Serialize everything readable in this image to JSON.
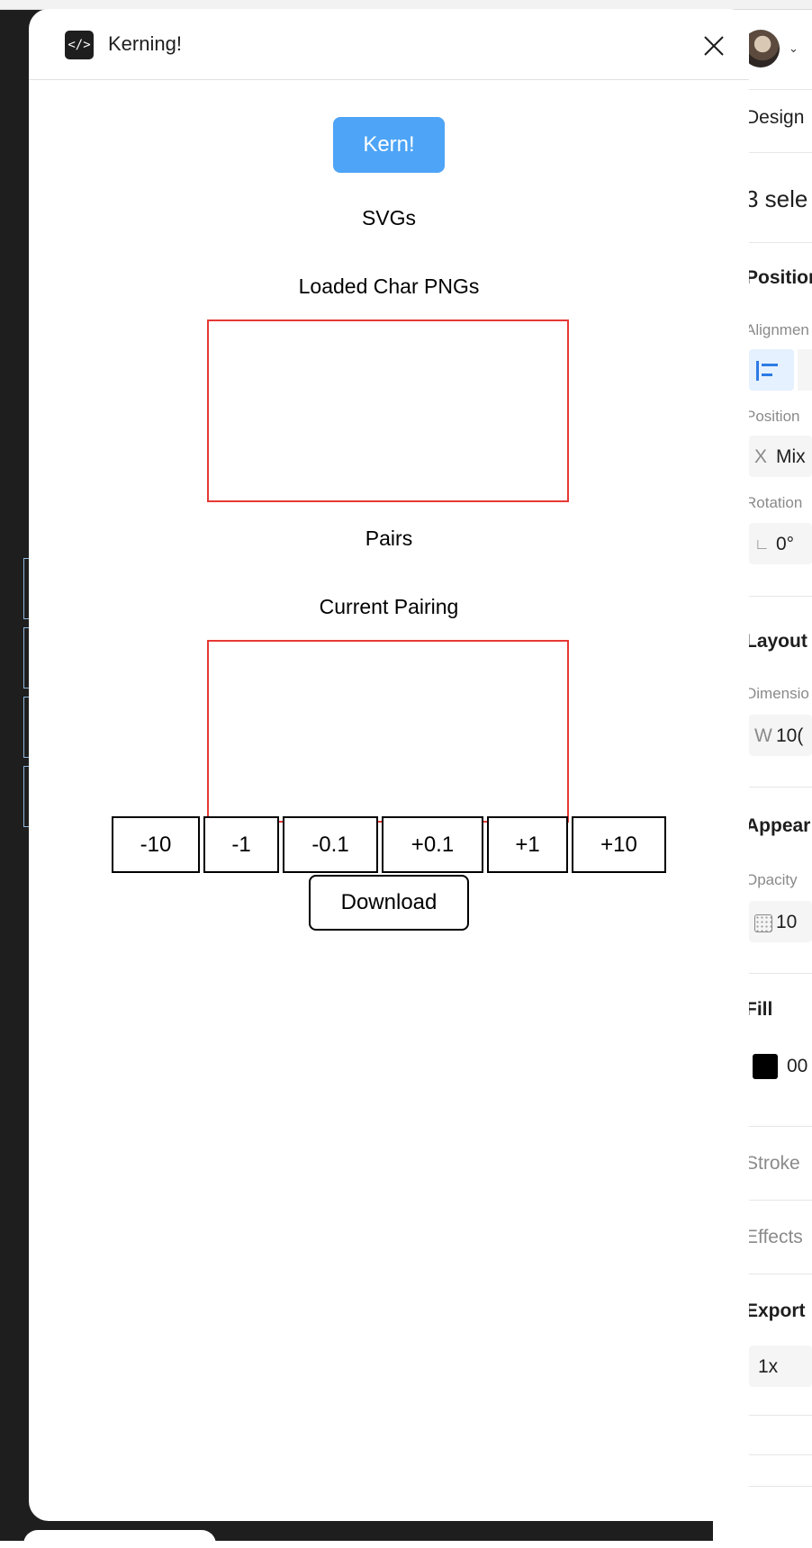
{
  "modal": {
    "title": "Kerning!",
    "icon": "code-icon",
    "icon_glyph": "</>",
    "kern_button": "Kern!",
    "svgs_label": "SVGs",
    "loaded_label": "Loaded Char PNGs",
    "pairs_label": "Pairs",
    "current_label": "Current Pairing",
    "adjust_buttons": [
      "-10",
      "-1",
      "-0.1",
      "+0.1",
      "+1",
      "+10"
    ],
    "download_button": "Download",
    "accent_color": "#4ea4f6",
    "box_border_color": "#e53935"
  },
  "design_panel": {
    "tab": "Design",
    "selection": "3 sele",
    "position_title": "Position",
    "alignment_label": "Alignmen",
    "position_label": "Position",
    "x_axis": "X",
    "x_value": "Mix",
    "rotation_label": "Rotation",
    "rotation_value": "0°",
    "layout_title": "Layout",
    "dimensions_label": "Dimensio",
    "w_axis": "W",
    "w_value": "10(",
    "appearance_title": "Appear",
    "opacity_label": "Opacity",
    "opacity_value": "10",
    "fill_title": "Fill",
    "fill_value": "00",
    "fill_color": "#000000",
    "stroke_title": "Stroke",
    "effects_title": "Effects",
    "export_title": "Export",
    "export_scale": "1x"
  }
}
